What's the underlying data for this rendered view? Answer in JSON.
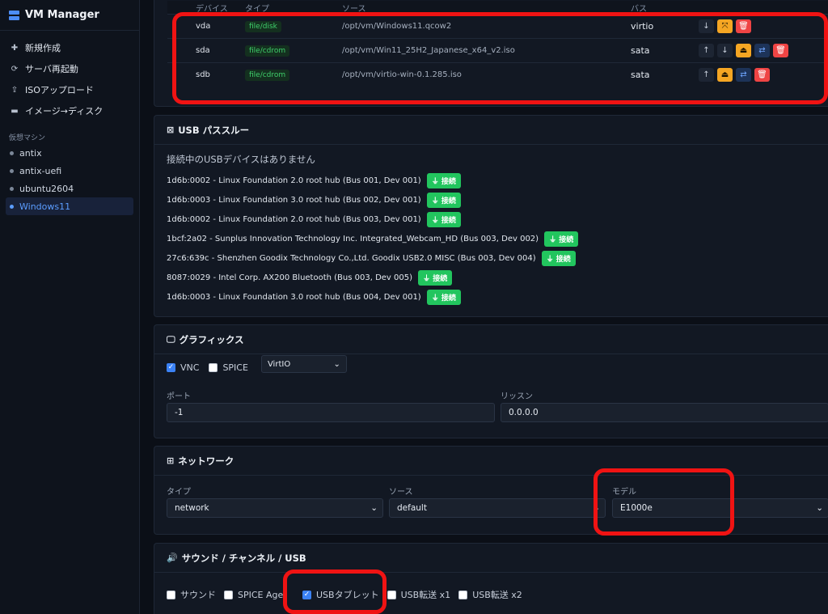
{
  "sidebar": {
    "brand": "VM Manager",
    "nav": [
      {
        "label": "新規作成",
        "icon": "plus-circle-icon"
      },
      {
        "label": "サーバ再起動",
        "icon": "refresh-icon"
      },
      {
        "label": "ISOアップロード",
        "icon": "upload-icon"
      },
      {
        "label": "イメージ→ディスク",
        "icon": "storage-icon"
      }
    ],
    "vm_heading": "仮想マシン",
    "vms": [
      "antix",
      "antix-uefi",
      "ubuntu2604",
      "Windows11"
    ],
    "active_vm": "Windows11"
  },
  "disks": {
    "headers": {
      "device": "デバイス",
      "type": "タイプ",
      "source": "ソース",
      "bus": "バス"
    },
    "rows": [
      {
        "device": "vda",
        "type": "file/disk",
        "source": "/opt/vm/Windows11.qcow2",
        "bus": "virtio"
      },
      {
        "device": "sda",
        "type": "file/cdrom",
        "source": "/opt/vm/Win11_25H2_Japanese_x64_v2.iso",
        "bus": "sata"
      },
      {
        "device": "sdb",
        "type": "file/cdrom",
        "source": "/opt/vm/virtio-win-0.1.285.iso",
        "bus": "sata"
      }
    ]
  },
  "usb": {
    "title": "USB パススルー",
    "empty_text": "接続中のUSBデバイスはありません",
    "connect_label": "接続",
    "devices": [
      "1d6b:0002 - Linux Foundation 2.0 root hub (Bus 001, Dev 001)",
      "1d6b:0003 - Linux Foundation 3.0 root hub (Bus 002, Dev 001)",
      "1d6b:0002 - Linux Foundation 2.0 root hub (Bus 003, Dev 001)",
      "1bcf:2a02 - Sunplus Innovation Technology Inc. Integrated_Webcam_HD (Bus 003, Dev 002)",
      "27c6:639c - Shenzhen Goodix Technology Co.,Ltd. Goodix USB2.0 MISC (Bus 003, Dev 004)",
      "8087:0029 - Intel Corp. AX200 Bluetooth (Bus 003, Dev 005)",
      "1d6b:0003 - Linux Foundation 3.0 root hub (Bus 004, Dev 001)"
    ]
  },
  "graphics": {
    "title": "グラフィックス",
    "vnc_label": "VNC",
    "vnc_checked": true,
    "spice_label": "SPICE",
    "spice_checked": false,
    "video_model": "VirtIO",
    "port_label": "ポート",
    "port_value": "-1",
    "listen_label": "リッスン",
    "listen_value": "0.0.0.0"
  },
  "network": {
    "title": "ネットワーク",
    "type_label": "タイプ",
    "type_value": "network",
    "source_label": "ソース",
    "source_value": "default",
    "model_label": "モデル",
    "model_value": "E1000e"
  },
  "sound": {
    "title": "サウンド / チャンネル / USB",
    "options": [
      {
        "label": "サウンド",
        "checked": false
      },
      {
        "label": "SPICE Agent",
        "checked": false
      },
      {
        "label": "USBタブレット",
        "checked": true
      },
      {
        "label": "USB転送 x1",
        "checked": false
      },
      {
        "label": "USB転送 x2",
        "checked": false
      }
    ]
  },
  "colors": {
    "accent": "#3b82f6",
    "connect_green": "#22c55e",
    "warning_orange": "#f5a623",
    "danger_red": "#ef4444",
    "highlight_red": "#f01313"
  }
}
